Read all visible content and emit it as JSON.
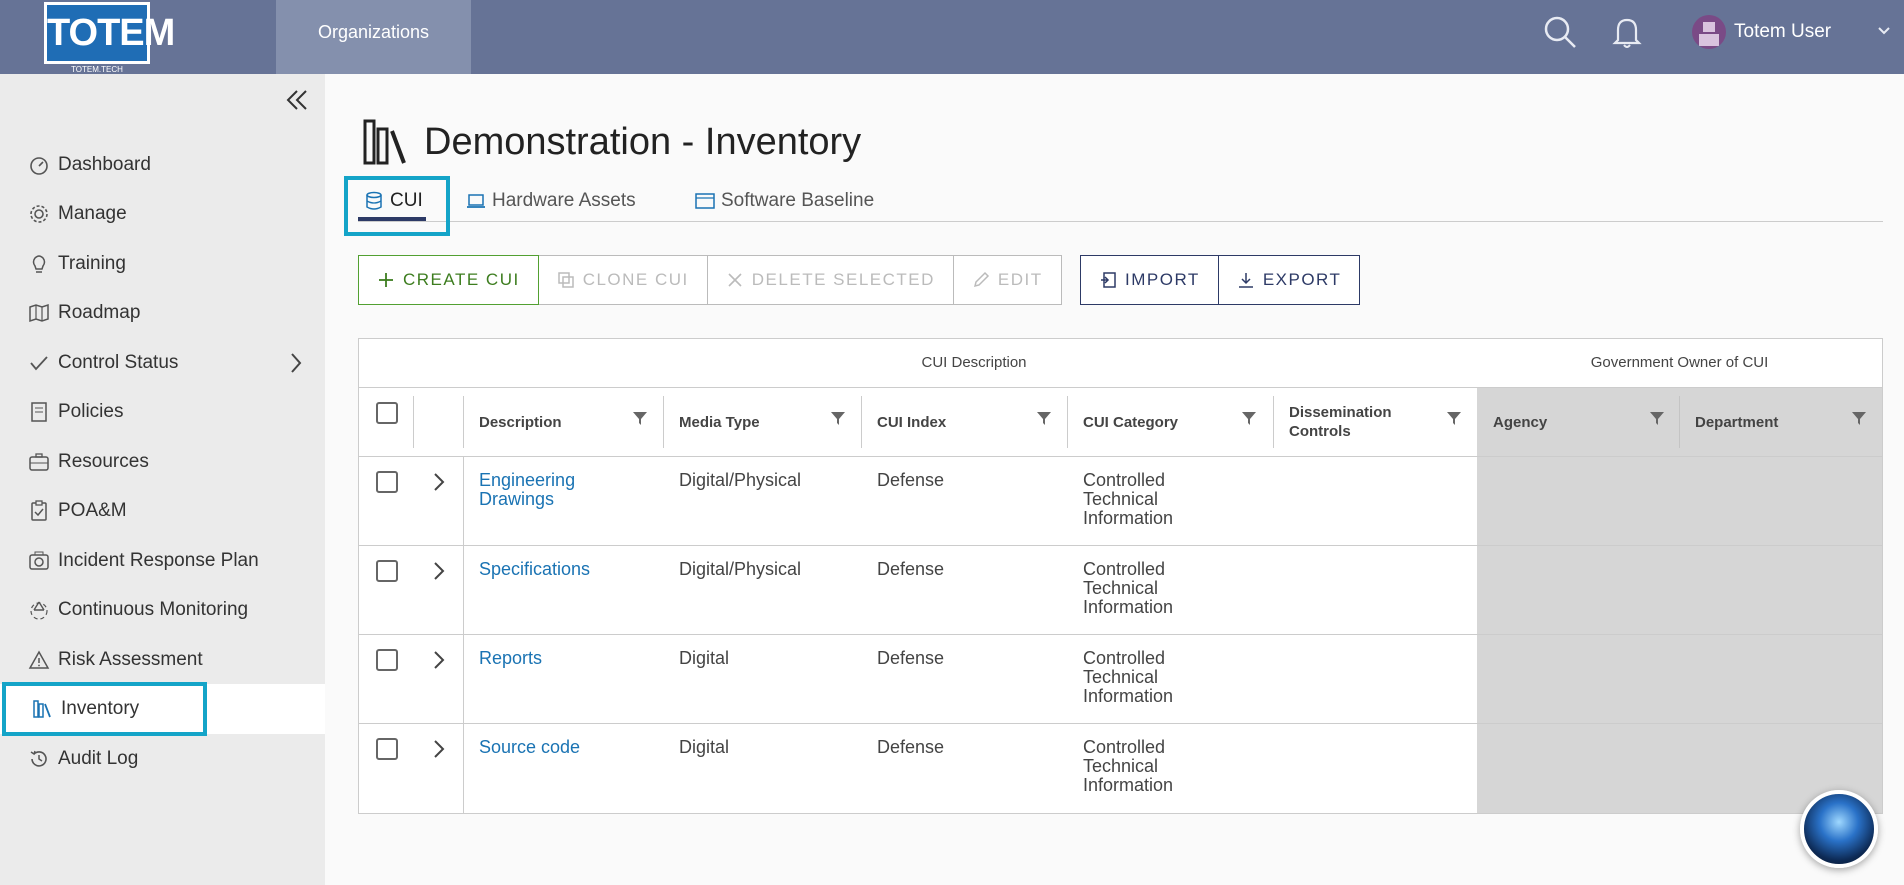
{
  "header": {
    "logo_text": "TOTEM",
    "logo_sub": "TOTEM.TECH",
    "org_label": "Organizations",
    "user_name": "Totem User"
  },
  "sidebar": {
    "items": [
      {
        "label": "Dashboard",
        "icon": "dashboard-icon"
      },
      {
        "label": "Manage",
        "icon": "gear-icon"
      },
      {
        "label": "Training",
        "icon": "lightbulb-icon"
      },
      {
        "label": "Roadmap",
        "icon": "map-icon"
      },
      {
        "label": "Control Status",
        "icon": "check-icon"
      },
      {
        "label": "Policies",
        "icon": "document-icon"
      },
      {
        "label": "Resources",
        "icon": "briefcase-icon"
      },
      {
        "label": "POA&M",
        "icon": "clipboard-icon"
      },
      {
        "label": "Incident Response Plan",
        "icon": "camera-icon"
      },
      {
        "label": "Continuous Monitoring",
        "icon": "recycle-icon"
      },
      {
        "label": "Risk Assessment",
        "icon": "warning-icon"
      },
      {
        "label": "Inventory",
        "icon": "books-icon"
      },
      {
        "label": "Audit Log",
        "icon": "history-icon"
      }
    ]
  },
  "page": {
    "title": "Demonstration - Inventory",
    "tabs": [
      {
        "label": "CUI",
        "active": true
      },
      {
        "label": "Hardware Assets",
        "active": false
      },
      {
        "label": "Software Baseline",
        "active": false
      }
    ]
  },
  "toolbar": {
    "create": "CREATE CUI",
    "clone": "CLONE CUI",
    "delete": "DELETE SELECTED",
    "edit": "EDIT",
    "import": "IMPORT",
    "export": "EXPORT"
  },
  "table": {
    "group_headers": [
      "CUI Description",
      "Government Owner of CUI"
    ],
    "columns": [
      "Description",
      "Media Type",
      "CUI Index",
      "CUI Category",
      "Dissemination Controls",
      "Agency",
      "Department"
    ],
    "rows": [
      {
        "description": "Engineering Drawings",
        "media_type": "Digital/Physical",
        "cui_index": "Defense",
        "cui_category": "Controlled Technical Information"
      },
      {
        "description": "Specifications",
        "media_type": "Digital/Physical",
        "cui_index": "Defense",
        "cui_category": "Controlled Technical Information"
      },
      {
        "description": "Reports",
        "media_type": "Digital",
        "cui_index": "Defense",
        "cui_category": "Controlled Technical Information"
      },
      {
        "description": "Source code",
        "media_type": "Digital",
        "cui_index": "Defense",
        "cui_category": "Controlled Technical Information"
      }
    ]
  },
  "colors": {
    "header_bg": "#667396",
    "accent": "#14a4c8",
    "link": "#1a73b3",
    "create_green": "#52a031",
    "navy": "#2d3a66"
  }
}
